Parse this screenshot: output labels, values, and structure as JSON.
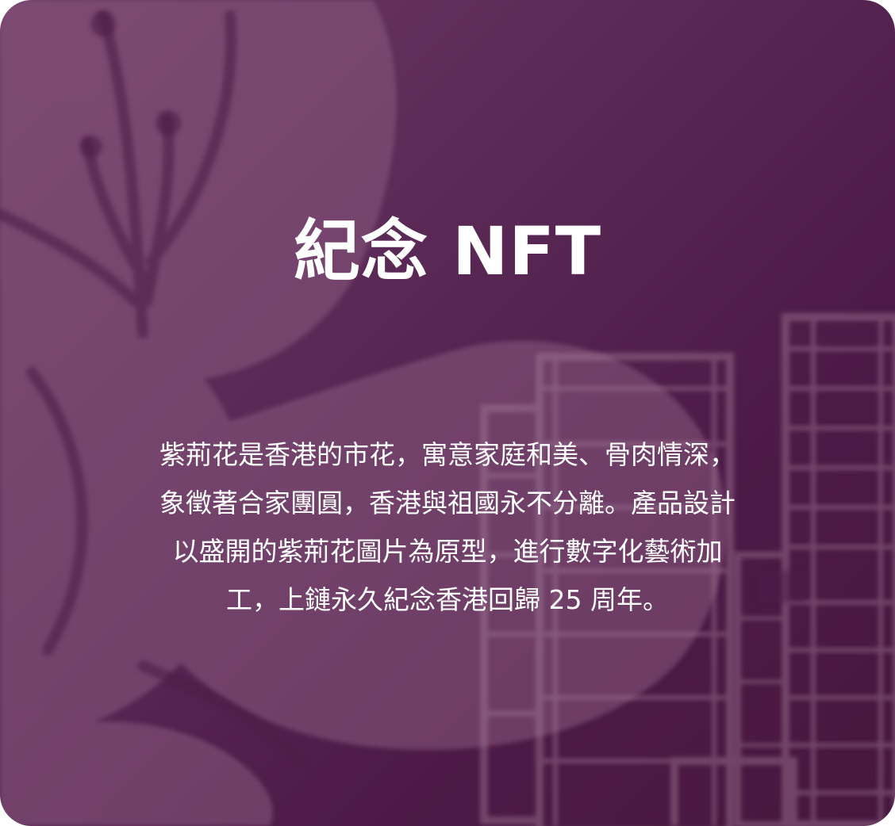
{
  "card": {
    "title": "紀念 NFT",
    "description_lines": [
      "紫荊花是香港的市花，寓意家庭和美、骨肉情深，",
      "象徵著合家團圓，香港與祖國永不分離。產品設計",
      "以盛開的紫荊花圖片為原型，進行數字化藝術加",
      "工，上鏈永久紀念香港回歸 25  周年。"
    ]
  },
  "colors": {
    "background": "#4d1a47",
    "petal": "#8a5a80",
    "building": "#a27a98",
    "text": "#ffffff"
  }
}
